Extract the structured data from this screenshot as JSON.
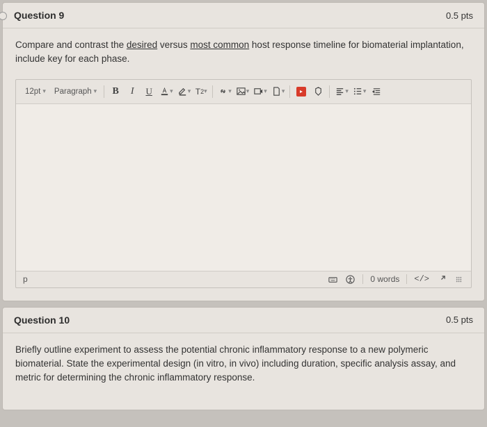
{
  "q9": {
    "title": "Question 9",
    "pts": "0.5 pts",
    "prompt_pre": "Compare and contrast the ",
    "prompt_u1": "desired",
    "prompt_mid": " versus ",
    "prompt_u2": "most common",
    "prompt_post": " host response timeline for biomaterial implantation, include key for each phase."
  },
  "toolbar": {
    "font_size": "12pt",
    "block": "Paragraph",
    "superscript": "T",
    "superscript_sup": "2"
  },
  "footer": {
    "path": "p",
    "word_count": "0 words",
    "html": "</>"
  },
  "q10": {
    "title": "Question 10",
    "pts": "0.5 pts",
    "prompt": "Briefly outline experiment to assess the potential chronic inflammatory response to a new polymeric biomaterial. State the experimental design (in vitro, in vivo) including duration, specific analysis assay, and metric for determining the chronic inflammatory response."
  }
}
